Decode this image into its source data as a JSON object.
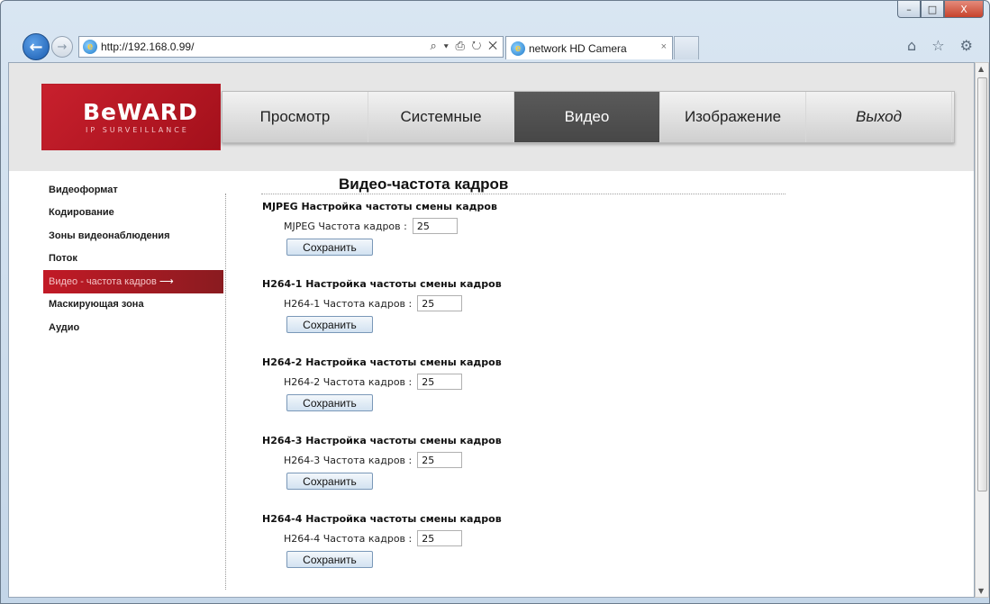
{
  "browser": {
    "url": "http://192.168.0.99/",
    "address_tools": "⌕ ▾ ⎙ ↻ ✕",
    "tab_title": "network HD Camera",
    "tab_close": "×",
    "tool_icons": "⌂ ☆ ⚙",
    "back_glyph": "←",
    "forward_glyph": "→",
    "min_glyph": "–",
    "max_glyph": "□",
    "close_glyph": "X"
  },
  "logo": {
    "text": "BeWARD",
    "subtitle": "IP SURVEILLANCE"
  },
  "menu": {
    "items": [
      {
        "label": "Просмотр"
      },
      {
        "label": "Системные"
      },
      {
        "label": "Видео"
      },
      {
        "label": "Изображение"
      },
      {
        "label": "Выход"
      }
    ]
  },
  "sidebar": {
    "items": [
      {
        "label": "Видеоформат"
      },
      {
        "label": "Кодирование"
      },
      {
        "label": "Зоны видеонаблюдения"
      },
      {
        "label": "Поток"
      },
      {
        "label": "Видео - частота кадров",
        "arrow": "⟶"
      },
      {
        "label": "Маскирующая зона"
      },
      {
        "label": "Аудио"
      }
    ]
  },
  "page": {
    "title": "Видео-частота кадров",
    "sections": [
      {
        "title": "MJPEG Настройка частоты смены кадров",
        "field_label": "MJPEG Частота кадров :",
        "value": "25",
        "button": "Сохранить"
      },
      {
        "title": "H264-1 Настройка частоты смены кадров",
        "field_label": "H264-1 Частота кадров :",
        "value": "25",
        "button": "Сохранить"
      },
      {
        "title": "H264-2 Настройка частоты смены кадров",
        "field_label": "H264-2 Частота кадров :",
        "value": "25",
        "button": "Сохранить"
      },
      {
        "title": "H264-3 Настройка частоты смены кадров",
        "field_label": "H264-3 Частота кадров :",
        "value": "25",
        "button": "Сохранить"
      },
      {
        "title": "H264-4 Настройка частоты смены кадров",
        "field_label": "H264-4 Частота кадров :",
        "value": "25",
        "button": "Сохранить"
      }
    ]
  },
  "colors": {
    "brand_red": "#c8202d",
    "active_menu": "#4f4f4f"
  }
}
